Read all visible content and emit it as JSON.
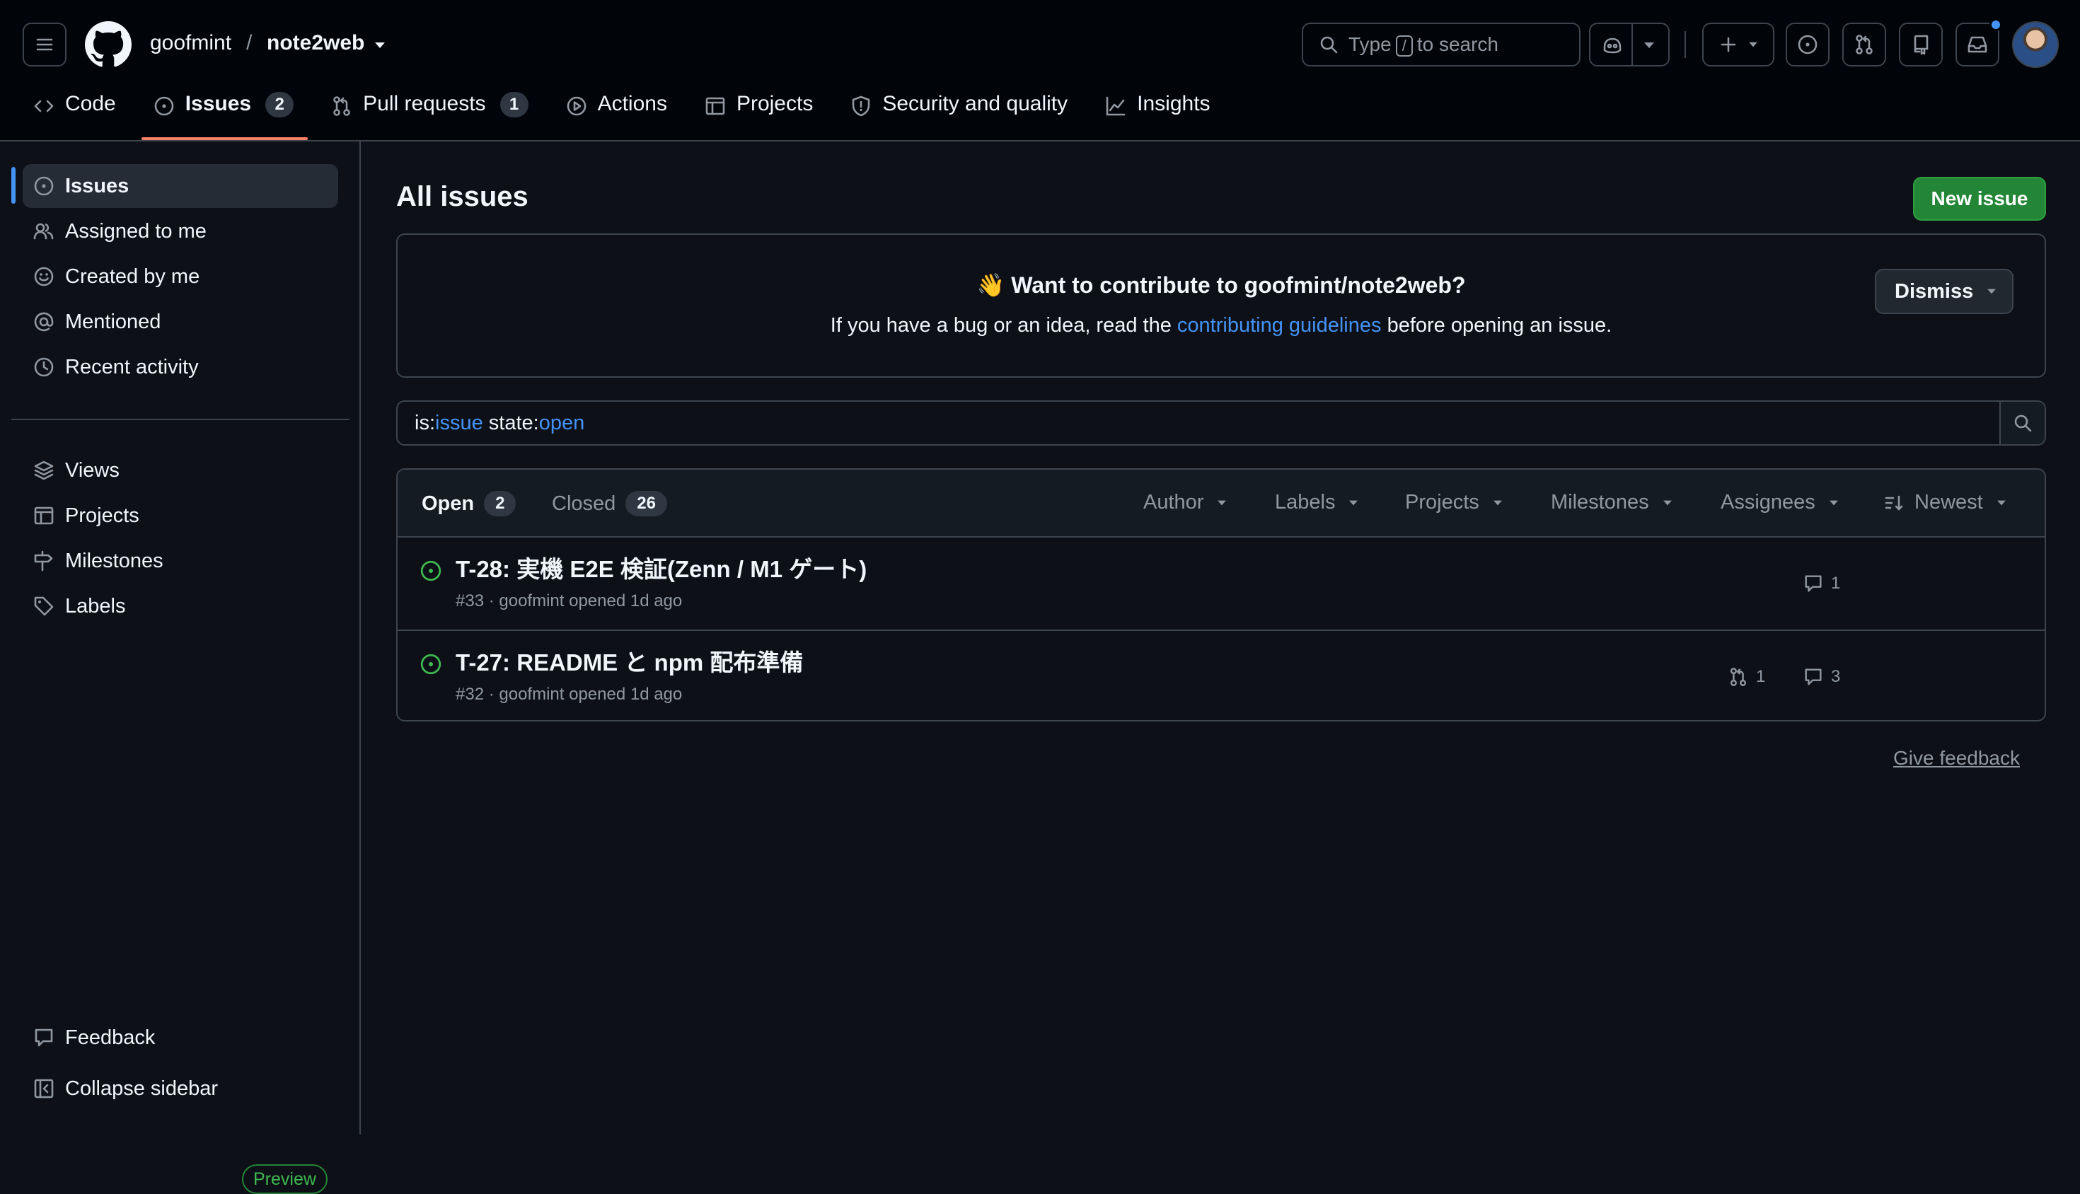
{
  "header": {
    "owner": "goofmint",
    "separator": "/",
    "repo": "note2web",
    "search_pre": "Type",
    "search_key": "/",
    "search_post": "to search",
    "icons": [
      "hamburger-icon",
      "github-logo",
      "copilot-icon",
      "plus-icon",
      "issue-opened-icon",
      "git-pull-request-icon",
      "repo-icon",
      "inbox-icon",
      "avatar"
    ]
  },
  "tabs": [
    {
      "label": "Code",
      "icon": "code-icon"
    },
    {
      "label": "Issues",
      "count": "2",
      "icon": "issue-opened-icon",
      "active": true
    },
    {
      "label": "Pull requests",
      "count": "1",
      "icon": "git-pull-request-icon"
    },
    {
      "label": "Actions",
      "icon": "play-icon"
    },
    {
      "label": "Projects",
      "icon": "table-icon"
    },
    {
      "label": "Security and quality",
      "icon": "shield-icon"
    },
    {
      "label": "Insights",
      "icon": "graph-icon"
    }
  ],
  "sidebar": {
    "top": [
      {
        "label": "Issues",
        "icon": "issue-opened-icon"
      },
      {
        "label": "Assigned to me",
        "icon": "people-icon"
      },
      {
        "label": "Created by me",
        "icon": "smiley-icon"
      },
      {
        "label": "Mentioned",
        "icon": "mention-icon"
      },
      {
        "label": "Recent activity",
        "icon": "clock-icon"
      }
    ],
    "bottom": [
      {
        "label": "Views",
        "icon": "stack-icon"
      },
      {
        "label": "Projects",
        "icon": "table-icon"
      },
      {
        "label": "Milestones",
        "icon": "milestone-icon"
      },
      {
        "label": "Labels",
        "icon": "tag-icon"
      }
    ],
    "feedback": "Feedback",
    "preview": "Preview",
    "collapse": "Collapse sidebar"
  },
  "main": {
    "title": "All issues",
    "new_issue": "New issue",
    "contribute": {
      "emoji": "👋",
      "title": "Want to contribute to goofmint/note2web?",
      "text_pre": "If you have a bug or an idea, read the ",
      "link": "contributing guidelines",
      "text_post": " before opening an issue.",
      "dismiss": "Dismiss"
    },
    "filter": {
      "p1": "is:",
      "q1": "issue",
      "p2": " state:",
      "q2": "open"
    },
    "states": {
      "open_label": "Open",
      "open_count": "2",
      "closed_label": "Closed",
      "closed_count": "26"
    },
    "filters": [
      "Author",
      "Labels",
      "Projects",
      "Milestones",
      "Assignees",
      "Newest"
    ],
    "issues": [
      {
        "title": "T-28: 実機 E2E 検証(Zenn / M1 ゲート)",
        "meta": "#33 · goofmint opened 1d ago",
        "prs": "",
        "comments": "1"
      },
      {
        "title": "T-27: README と npm 配布準備",
        "meta": "#32 · goofmint opened 1d ago",
        "prs": "1",
        "comments": "3"
      }
    ],
    "give_feedback": "Give feedback"
  },
  "colors": {
    "bg": "#0d1117",
    "header_bg": "#010409",
    "accent": "#f78166",
    "link": "#4493f8",
    "green": "#238636",
    "open_icon": "#3fb950"
  }
}
